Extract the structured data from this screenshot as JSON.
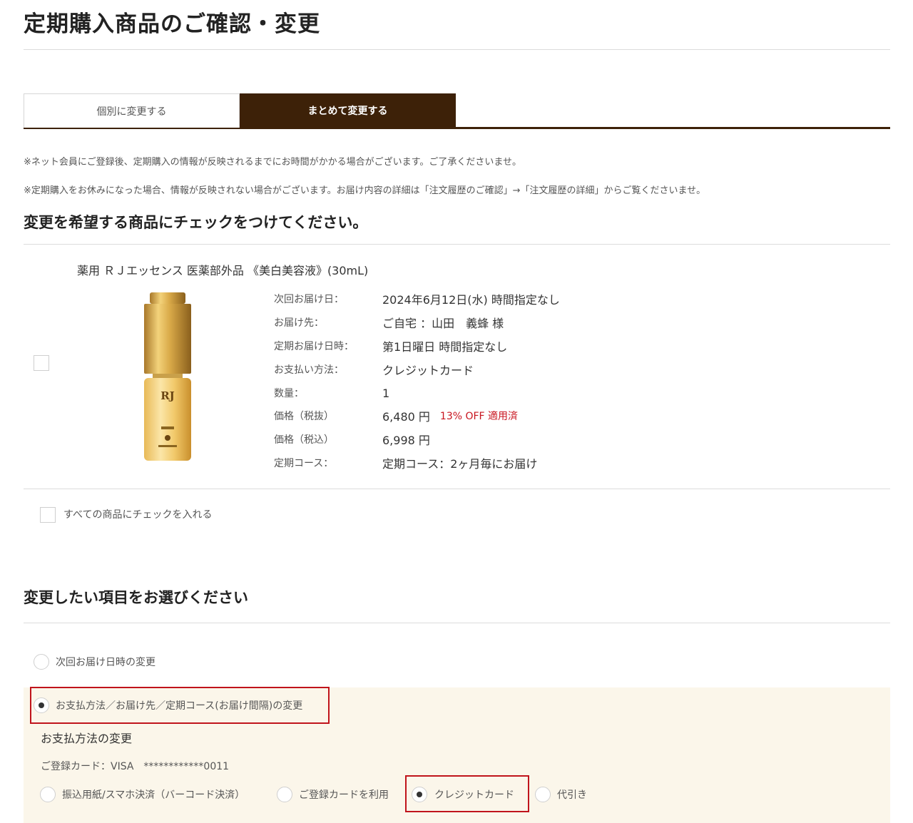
{
  "page": {
    "title": "定期購入商品のご確認・変更"
  },
  "tabs": [
    {
      "label": "個別に変更する",
      "active": false
    },
    {
      "label": "まとめて変更する",
      "active": true
    }
  ],
  "notes": [
    "※ネット会員にご登録後、定期購入の情報が反映されるまでにお時間がかかる場合がございます。ご了承くださいませ。",
    "※定期購入をお休みになった場合、情報が反映されない場合がございます。お届け内容の詳細は「注文履歴のご確認」→「注文履歴の詳細」からご覧くださいませ。"
  ],
  "product_section": {
    "heading": "変更を希望する商品にチェックをつけてください。",
    "product": {
      "name": "薬用 ＲＪエッセンス 医薬部外品 《美白美容液》(30mL)",
      "checked": false,
      "image_text": "RJ",
      "details": [
        {
          "label": "次回お届け日：",
          "value": "2024年6月12日(水) 時間指定なし"
        },
        {
          "label": "お届け先：",
          "value": "ご自宅 ：山田　義蜂 様"
        },
        {
          "label": "定期お届け日時：",
          "value": "第1日曜日 時間指定なし"
        },
        {
          "label": "お支払い方法：",
          "value": "クレジットカード"
        },
        {
          "label": "数量：",
          "value": "1"
        },
        {
          "label": "価格（税抜）",
          "value": "6,480 円",
          "badge": "13% OFF 適用済"
        },
        {
          "label": "価格（税込）",
          "value": "6,998 円"
        },
        {
          "label": "定期コース：",
          "value": "定期コース：2ヶ月毎にお届け"
        }
      ]
    },
    "check_all_label": "すべての商品にチェックを入れる"
  },
  "change_section": {
    "heading": "変更したい項目をお選びください",
    "options": [
      {
        "label": "次回お届け日時の変更",
        "selected": false
      },
      {
        "label": "お支払方法／お届け先／定期コース(お届け間隔)の変更",
        "selected": true
      }
    ],
    "payment": {
      "heading": "お支払方法の変更",
      "registered_card": "ご登録カード：VISA　************0011",
      "methods": [
        {
          "label": "振込用紙/スマホ決済（バーコード決済）",
          "selected": false
        },
        {
          "label": "ご登録カードを利用",
          "selected": false
        },
        {
          "label": "クレジットカード",
          "selected": true
        },
        {
          "label": "代引き",
          "selected": false
        }
      ]
    }
  },
  "colors": {
    "brand_dark": "#3d2108",
    "highlight_red": "#c0141c",
    "discount_red": "#c8141e",
    "panel_beige": "#fbf6ea",
    "gold": "#d4a43a"
  }
}
